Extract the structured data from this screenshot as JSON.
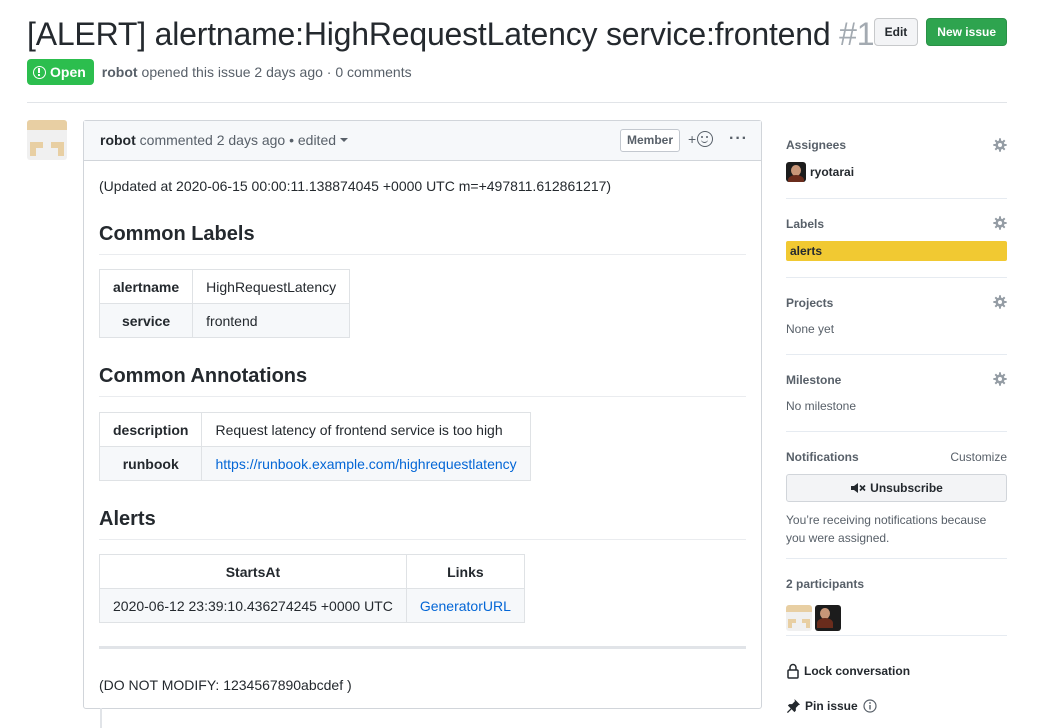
{
  "issue": {
    "title": "[ALERT] alertname:HighRequestLatency service:frontend",
    "number": "#1",
    "edit_label": "Edit",
    "new_issue_label": "New issue",
    "state": "Open",
    "author": "robot",
    "opened_text": "opened this issue 2 days ago · 0 comments"
  },
  "comment": {
    "author": "robot",
    "meta": "commented 2 days ago",
    "edited": "• edited",
    "badge": "Member",
    "reaction_plus": "+",
    "menu": "···",
    "updated_text": "(Updated at 2020-06-15 00:00:11.138874045 +0000 UTC m=+497811.612861217)",
    "footer_text": "(DO NOT MODIFY: 1234567890abcdef )",
    "common_labels": {
      "heading": "Common Labels",
      "rows": [
        {
          "key": "alertname",
          "value": "HighRequestLatency"
        },
        {
          "key": "service",
          "value": "frontend"
        }
      ]
    },
    "common_annotations": {
      "heading": "Common Annotations",
      "rows": [
        {
          "key": "description",
          "value": "Request latency of frontend service is too high"
        },
        {
          "key": "runbook",
          "value": "https://runbook.example.com/highrequestlatency"
        }
      ]
    },
    "alerts": {
      "heading": "Alerts",
      "columns": [
        "StartsAt",
        "Links"
      ],
      "rows": [
        {
          "starts_at": "2020-06-12 23:39:10.436274245 +0000 UTC",
          "link": "GeneratorURL"
        }
      ]
    }
  },
  "sidebar": {
    "assignees": {
      "heading": "Assignees",
      "user": "ryotarai"
    },
    "labels": {
      "heading": "Labels",
      "label": "alerts",
      "label_color": "#f1c932"
    },
    "projects": {
      "heading": "Projects",
      "value": "None yet"
    },
    "milestone": {
      "heading": "Milestone",
      "value": "No milestone"
    },
    "notifications": {
      "heading": "Notifications",
      "customize": "Customize",
      "button": "Unsubscribe",
      "note": "You’re receiving notifications because you were assigned."
    },
    "participants": {
      "heading": "2 participants"
    },
    "lock": "Lock conversation",
    "pin": "Pin issue"
  },
  "colors": {
    "open_green": "#2cbe4e",
    "primary_button": "#2ea44f",
    "link_blue": "#0366d6"
  }
}
